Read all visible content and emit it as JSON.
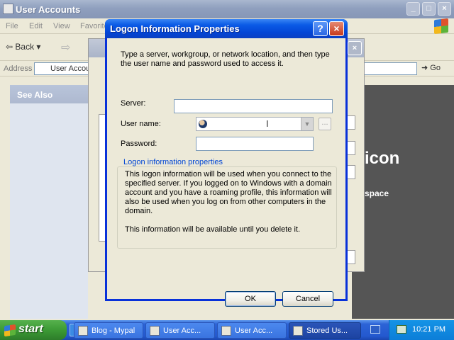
{
  "background_window": {
    "title": "User Accounts",
    "menu": [
      "File",
      "Edit",
      "View",
      "Favorites"
    ],
    "toolbar": {
      "back_label": "Back"
    },
    "address": {
      "label": "Address",
      "value": "User Accou",
      "go_label": "Go"
    },
    "side_panel": {
      "heading": "See Also",
      "link": ""
    },
    "right_panel": {
      "icon_text": "icon",
      "space_text": "space"
    }
  },
  "dialog": {
    "title": "Logon Information Properties",
    "intro": "Type a server, workgroup, or network location, and then type the user name and password used to access it.",
    "server": {
      "label": "Server:",
      "value": ""
    },
    "username": {
      "label": "User name:",
      "value": ""
    },
    "password": {
      "label": "Password:",
      "value": ""
    },
    "group": {
      "legend": "Logon information properties",
      "text1": "This logon information will be used when you connect to the specified server. If you logged on to Windows with a domain account and you have a roaming profile, this information will also be used when you log on from other computers in the domain.",
      "text2": "This information will be available until you delete it."
    },
    "ok_label": "OK",
    "cancel_label": "Cancel",
    "ellipsis_label": "..."
  },
  "taskbar": {
    "start_label": "start",
    "tasks": [
      {
        "label": "Blog - Mypal"
      },
      {
        "label": "User Acc..."
      },
      {
        "label": "User Acc..."
      },
      {
        "label": "Stored Us..."
      }
    ],
    "clock": "10:21 PM"
  },
  "colors": {
    "title_active": "#0345d6",
    "close_red": "#c7391b",
    "taskbar_blue": "#2459cf",
    "start_green": "#3c9a35"
  }
}
